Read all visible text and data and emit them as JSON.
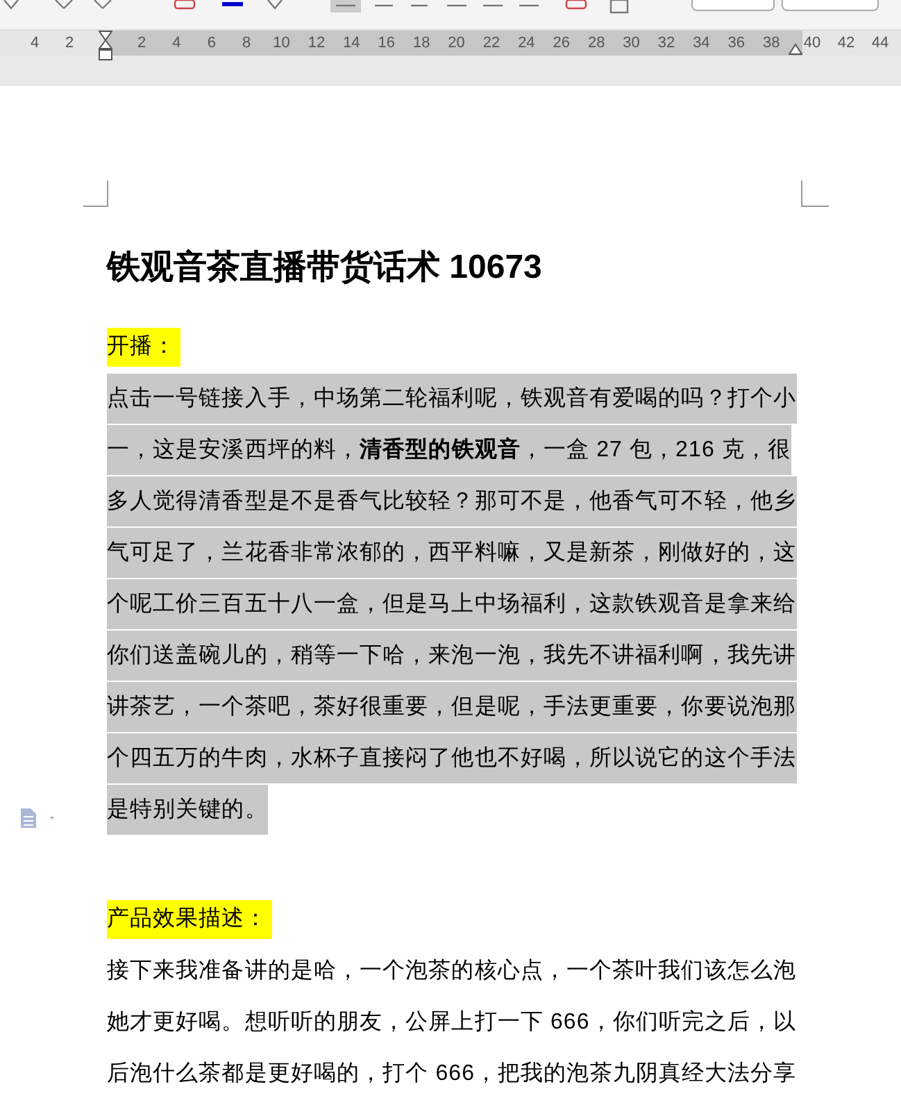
{
  "ruler": {
    "left_ticks": [
      "4",
      "2"
    ],
    "ticks": [
      "2",
      "4",
      "6",
      "8",
      "10",
      "12",
      "14",
      "16",
      "18",
      "20",
      "22",
      "24",
      "26",
      "28",
      "30",
      "32",
      "34",
      "36",
      "38"
    ],
    "right_ticks": [
      "40",
      "42",
      "44"
    ]
  },
  "document": {
    "title": "铁观音茶直播带货话术 10673",
    "blocks": [
      {
        "kind": "heading",
        "highlighted": true,
        "color": "#ffff00",
        "text": "开播："
      },
      {
        "kind": "paragraph",
        "highlighted": true,
        "color": "#c8c8c8",
        "lines": [
          "点击一号链接入手，中场第二轮福利呢，铁观音有爱喝的吗？打个小",
          "一，这是安溪西坪的料，**清香型的铁观音**，一盒 27 包，216 克，很",
          "多人觉得清香型是不是香气比较轻？那可不是，他香气可不轻，他乡",
          "气可足了，兰花香非常浓郁的，西平料嘛，又是新茶，刚做好的，这",
          "个呢工价三百五十八一盒，但是马上中场福利，这款铁观音是拿来给",
          "你们送盖碗儿的，稍等一下哈，来泡一泡，我先不讲福利啊，我先讲",
          "讲茶艺，一个茶吧，茶好很重要，但是呢，手法更重要，你要说泡那",
          "个四五万的牛肉，水杯子直接闷了他也不好喝，所以说它的这个手法",
          "是特别关键的。"
        ]
      },
      {
        "kind": "heading",
        "highlighted": true,
        "color": "#ffff00",
        "text": "产品效果描述："
      },
      {
        "kind": "paragraph",
        "highlighted": false,
        "lines": [
          "接下来我准备讲的是哈，一个泡茶的核心点，一个茶叶我们该怎么泡",
          "她才更好喝。想听听的朋友，公屏上打一下 666，你们听完之后，以",
          "后泡什么茶都是更好喝的，打个 666，把我的泡茶九阴真经大法分享"
        ]
      }
    ]
  }
}
